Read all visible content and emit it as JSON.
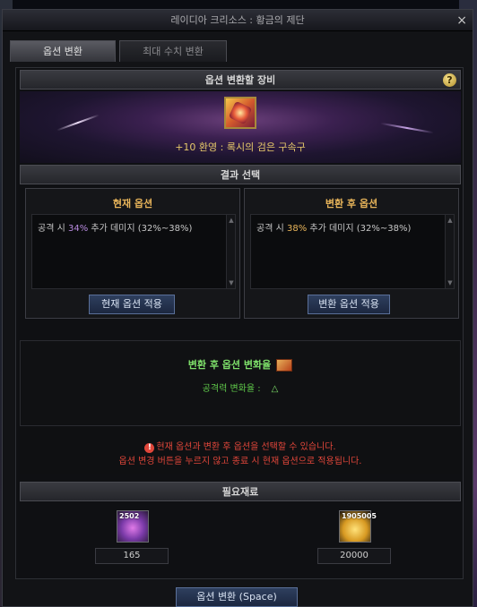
{
  "window": {
    "title": "레이디아 크리소스 : 황금의 제단",
    "close_label": "×"
  },
  "tabs": [
    {
      "label": "옵션 변환",
      "active": true
    },
    {
      "label": "최대 수치 변환",
      "active": false
    }
  ],
  "equipment": {
    "header": "옵션 변환할 장비",
    "help_label": "?",
    "item_name": "+10 환영 : 록시의 검은 구속구",
    "icon": "equipment-item-icon"
  },
  "result": {
    "header": "결과 선택",
    "current": {
      "title": "현재 옵션",
      "prefix": "공격 시 ",
      "value": "34%",
      "suffix": " 추가 데미지 (32%~38%)",
      "button": "현재 옵션 적용"
    },
    "after": {
      "title": "변환 후 옵션",
      "prefix": "공격 시 ",
      "value": "38%",
      "suffix": " 추가 데미지 (32%~38%)",
      "button": "변환 옵션 적용"
    }
  },
  "rate": {
    "title": "변환 후 옵션 변화율",
    "line_label": "공격력 변화율 :",
    "line_symbol": "△"
  },
  "warning": {
    "line1": "현재 옵션과 변환 후 옵션을 선택할 수 있습니다.",
    "line2": "옵션 변경 버튼을 누르지 않고 종료 시 현재 옵션으로 적용됩니다.",
    "icon_symbol": "!"
  },
  "materials": {
    "header": "필요재료",
    "items": [
      {
        "badge": "2502",
        "amount": "165",
        "icon": "purple-crystal-icon"
      },
      {
        "badge": "1905005",
        "amount": "20000",
        "icon": "gold-coins-icon"
      }
    ]
  },
  "footer": {
    "button": "옵션 변환 (Space)"
  }
}
